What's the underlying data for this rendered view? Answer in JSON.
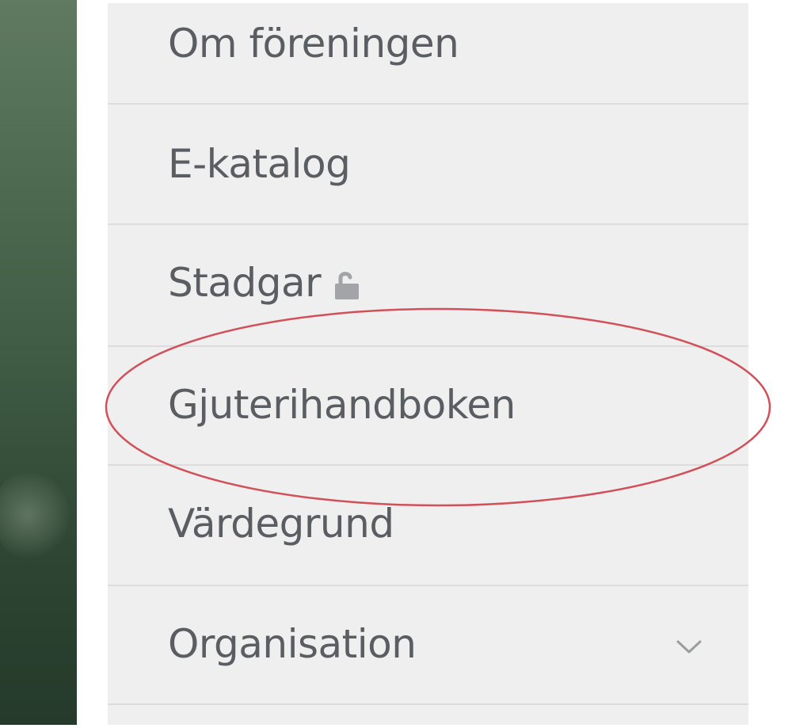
{
  "menu": {
    "items": [
      {
        "label": "Om föreningen"
      },
      {
        "label": "E-katalog"
      },
      {
        "label": "Stadgar",
        "icon": "lock-icon"
      },
      {
        "label": "Gjuterihandboken"
      },
      {
        "label": "Värdegrund"
      },
      {
        "label": "Organisation",
        "icon": "chevron-down-icon"
      }
    ]
  },
  "colors": {
    "menu_background": "#efefef",
    "divider": "#dcdcdc",
    "text": "#5a5d61",
    "highlight_ellipse": "#d2505a"
  }
}
